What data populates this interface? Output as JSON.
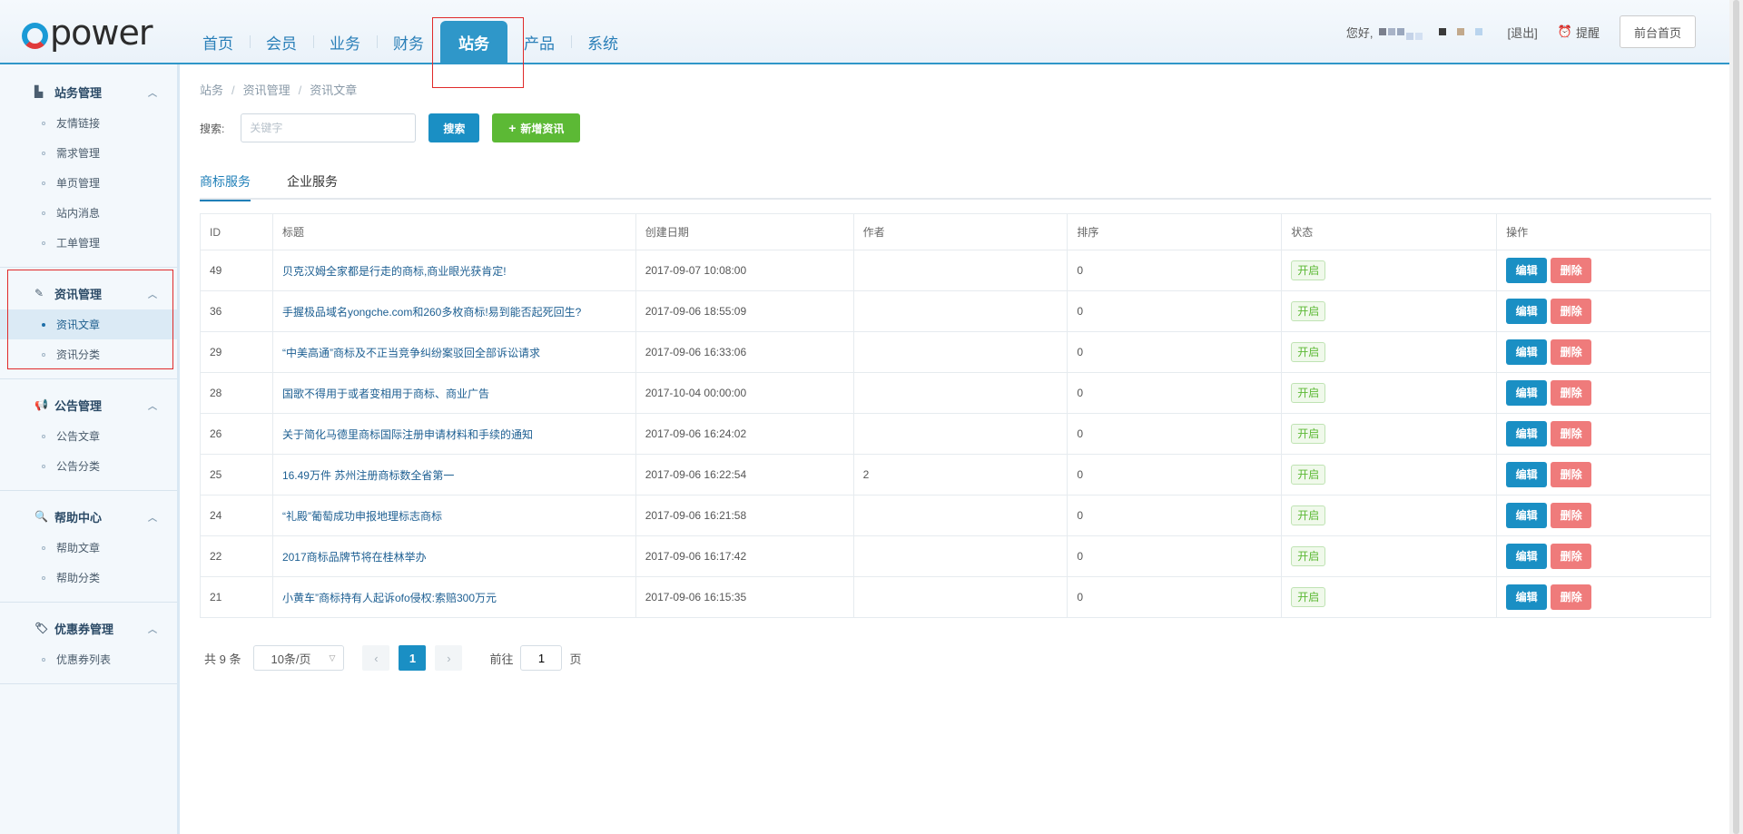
{
  "header": {
    "logo": "power",
    "nav": [
      {
        "label": "首页"
      },
      {
        "label": "会员"
      },
      {
        "label": "业务"
      },
      {
        "label": "财务"
      },
      {
        "label": "站务"
      },
      {
        "label": "产品"
      },
      {
        "label": "系统"
      }
    ],
    "greeting": "您好,",
    "logout": "[退出]",
    "remind": "提醒",
    "front_home": "前台首页"
  },
  "sidebar": {
    "groups": [
      {
        "title": "站务管理",
        "items": [
          "友情链接",
          "需求管理",
          "单页管理",
          "站内消息",
          "工单管理"
        ]
      },
      {
        "title": "资讯管理",
        "items": [
          "资讯文章",
          "资讯分类"
        ]
      },
      {
        "title": "公告管理",
        "items": [
          "公告文章",
          "公告分类"
        ]
      },
      {
        "title": "帮助中心",
        "items": [
          "帮助文章",
          "帮助分类"
        ]
      },
      {
        "title": "优惠券管理",
        "items": [
          "优惠券列表"
        ]
      }
    ]
  },
  "breadcrumb": [
    "站务",
    "资讯管理",
    "资讯文章"
  ],
  "search": {
    "label": "搜索:",
    "placeholder": "关键字",
    "button": "搜索",
    "add_button": "新增资讯"
  },
  "tabs": [
    "商标服务",
    "企业服务"
  ],
  "table": {
    "headers": [
      "ID",
      "标题",
      "创建日期",
      "作者",
      "排序",
      "状态",
      "操作"
    ],
    "status_label": "开启",
    "edit_label": "编辑",
    "delete_label": "删除",
    "rows": [
      {
        "id": "49",
        "title": "贝克汉姆全家都是行走的商标,商业眼光获肯定!",
        "date": "2017-09-07 10:08:00",
        "author": "",
        "sort": "0"
      },
      {
        "id": "36",
        "title": "手握极品域名yongche.com和260多枚商标!易到能否起死回生?",
        "date": "2017-09-06 18:55:09",
        "author": "",
        "sort": "0"
      },
      {
        "id": "29",
        "title": "“中美高通”商标及不正当竞争纠纷案驳回全部诉讼请求",
        "date": "2017-09-06 16:33:06",
        "author": "",
        "sort": "0"
      },
      {
        "id": "28",
        "title": "国歌不得用于或者变相用于商标、商业广告",
        "date": "2017-10-04 00:00:00",
        "author": "",
        "sort": "0"
      },
      {
        "id": "26",
        "title": "关于简化马德里商标国际注册申请材料和手续的通知",
        "date": "2017-09-06 16:24:02",
        "author": "",
        "sort": "0"
      },
      {
        "id": "25",
        "title": "16.49万件 苏州注册商标数全省第一",
        "date": "2017-09-06 16:22:54",
        "author": "2",
        "sort": "0"
      },
      {
        "id": "24",
        "title": "“礼殿”葡萄成功申报地理标志商标",
        "date": "2017-09-06 16:21:58",
        "author": "",
        "sort": "0"
      },
      {
        "id": "22",
        "title": "2017商标品牌节将在桂林举办",
        "date": "2017-09-06 16:17:42",
        "author": "",
        "sort": "0"
      },
      {
        "id": "21",
        "title": "小黄车”商标持有人起诉ofo侵权:索赔300万元",
        "date": "2017-09-06 16:15:35",
        "author": "",
        "sort": "0"
      }
    ]
  },
  "pagination": {
    "total": "共 9 条",
    "page_size": "10条/页",
    "current": "1",
    "goto_prefix": "前往",
    "goto_value": "1",
    "goto_suffix": "页"
  }
}
